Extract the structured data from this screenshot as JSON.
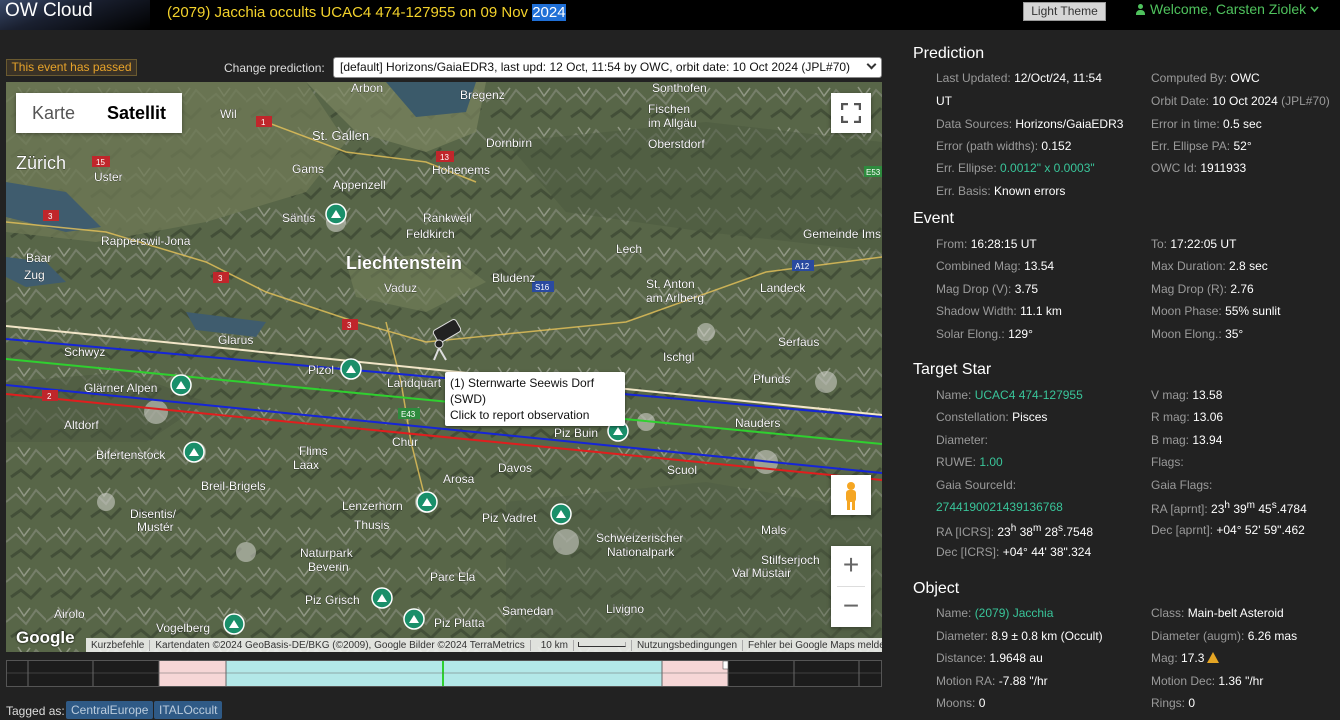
{
  "header": {
    "logo": "OW Cloud",
    "title_main": "(2079) Jacchia occults UCAC4 474-127955 on 09 Nov ",
    "title_year": "2024",
    "theme_button": "Light Theme",
    "welcome": "Welcome, Carsten Ziolek"
  },
  "controls": {
    "passed_badge": "This event has passed",
    "change_label": "Change prediction:",
    "prediction_selected": "[default] Horizons/GaiaEDR3, last upd: 12 Oct, 11:54 by OWC, orbit date: 10 Oct 2024 (JPL#70)"
  },
  "map": {
    "type_buttons": [
      "Karte",
      "Satellit"
    ],
    "active_type": "Satellit",
    "tooltip_line1": "(1) Sternwarte Seewis Dorf (SWD)",
    "tooltip_line2": "Click to report observation",
    "zoom_in": "+",
    "zoom_out": "−",
    "google": "Google",
    "footer": [
      "Kurzbefehle",
      "Kartendaten ©2024 GeoBasis-DE/BKG (©2009), Google Bilder ©2024 TerraMetrics",
      "10 km",
      "Nutzungsbedingungen",
      "Fehler bei Google Maps melden"
    ],
    "labels": [
      "Arbon",
      "Sonthofen",
      "Fischen im Allgäu",
      "Bregenz",
      "St. Gallen",
      "Dornbirn",
      "Oberstdorf",
      "Zürich",
      "Uster",
      "Hohenems",
      "Appenzell",
      "Rapperswil-Jona",
      "Säntis",
      "Rankweil",
      "Feldkirch",
      "Lech",
      "Gemeinde Ims",
      "Liechtenstein",
      "Bludenz",
      "Vaduz",
      "St. Anton am Arlberg",
      "Landeck",
      "Baar",
      "Zug",
      "Glarus",
      "Schwyz",
      "Glärner Alpen",
      "Pizol",
      "Landquart",
      "Serfaus",
      "Pfunds",
      "Ischgl",
      "Nauders",
      "Altdorf",
      "Chur",
      "Piz Buin",
      "Bifertenstock",
      "Flims",
      "Laax",
      "Davos",
      "Scuol",
      "Breil-Brigels",
      "Arosa",
      "Disentis/Mustér",
      "Lenzerhorn",
      "Thusis",
      "Piz Vadret",
      "Schweizerischer Nationalpark",
      "Mals",
      "Naturpark Beverin",
      "Val Müstair",
      "Stilfserjoch",
      "Parc Ela",
      "Piz Grisch",
      "Livigno",
      "Airolo",
      "Vogelberg",
      "Piz Platta",
      "Samedan",
      "Wil",
      "Gams"
    ],
    "road_labels": [
      "1",
      "13",
      "15",
      "3",
      "3",
      "3",
      "2",
      "E43",
      "S16",
      "A12",
      "E53",
      "13"
    ]
  },
  "tags": {
    "label": "Tagged as:",
    "items": [
      "CentralEurope",
      "ITALOccult"
    ]
  },
  "prediction": {
    "heading": "Prediction",
    "last_updated_k": "Last Updated:",
    "last_updated_v": "12/Oct/24, 11:54",
    "last_updated_v2": "UT",
    "computed_by_k": "Computed By:",
    "computed_by_v": "OWC",
    "orbit_date_k": "Orbit Date:",
    "orbit_date_v": "10 Oct 2024",
    "orbit_date_v2": "(JPL#70)",
    "data_sources_k": "Data Sources:",
    "data_sources_v": "Horizons/GaiaEDR3",
    "error_time_k": "Error in time:",
    "error_time_v": "0.5 sec",
    "error_path_k": "Error (path widths):",
    "error_path_v": "0.152",
    "err_ellipse_pa_k": "Err. Ellipse PA:",
    "err_ellipse_pa_v": "52°",
    "err_ellipse_k": "Err. Ellipse:",
    "err_ellipse_v": "0.0012\" x 0.0003\"",
    "owc_id_k": "OWC Id:",
    "owc_id_v": "1911933",
    "err_basis_k": "Err. Basis:",
    "err_basis_v": "Known errors"
  },
  "event": {
    "heading": "Event",
    "from_k": "From:",
    "from_v": "16:28:15 UT",
    "to_k": "To:",
    "to_v": "17:22:05 UT",
    "comb_mag_k": "Combined Mag:",
    "comb_mag_v": "13.54",
    "max_dur_k": "Max Duration:",
    "max_dur_v": "2.8 sec",
    "mag_drop_v_k": "Mag Drop (V):",
    "mag_drop_v_v": "3.75",
    "mag_drop_r_k": "Mag Drop (R):",
    "mag_drop_r_v": "2.76",
    "shadow_k": "Shadow Width:",
    "shadow_v": "11.1 km",
    "moon_phase_k": "Moon Phase:",
    "moon_phase_v": "55% sunlit",
    "solar_el_k": "Solar Elong.:",
    "solar_el_v": "129°",
    "moon_el_k": "Moon Elong.:",
    "moon_el_v": "35°"
  },
  "star": {
    "heading": "Target Star",
    "name_k": "Name:",
    "name_v": "UCAC4 474-127955",
    "vmag_k": "V mag:",
    "vmag_v": "13.58",
    "const_k": "Constellation:",
    "const_v": "Pisces",
    "rmag_k": "R mag:",
    "rmag_v": "13.06",
    "diam_k": "Diameter:",
    "bmag_k": "B mag:",
    "bmag_v": "13.94",
    "ruwe_k": "RUWE:",
    "ruwe_v": "1.00",
    "flags_k": "Flags:",
    "gaia_src_k": "Gaia SourceId:",
    "gaia_flags_k": "Gaia Flags:",
    "gaia_src_v": "2744190021439136768",
    "ra_aprnt_k": "RA [aprnt]:",
    "ra_aprnt_h": "23",
    "ra_aprnt_m": "39",
    "ra_aprnt_s": "45",
    "ra_aprnt_f": ".4784",
    "ra_icrs_k": "RA [ICRS]:",
    "ra_icrs_h": "23",
    "ra_icrs_m": "38",
    "ra_icrs_s": "28",
    "ra_icrs_f": ".7548",
    "dec_aprnt_k": "Dec [aprnt]:",
    "dec_aprnt_v": "+04° 52' 59\".462",
    "dec_icrs_k": "Dec [ICRS]:",
    "dec_icrs_v": "+04° 44' 38\".324"
  },
  "object": {
    "heading": "Object",
    "name_k": "Name:",
    "name_v": "(2079) Jacchia",
    "class_k": "Class:",
    "class_v": "Main-belt Asteroid",
    "diam_k": "Diameter:",
    "diam_v": "8.9 ± 0.8 km",
    "diam_src": "(Occult)",
    "diam_augm_k": "Diameter (augm):",
    "diam_augm_v": "6.26 mas",
    "dist_k": "Distance:",
    "dist_v": "1.9648 au",
    "mag_k": "Mag:",
    "mag_v": "17.3",
    "mra_k": "Motion RA:",
    "mra_v": "-7.88 \"/hr",
    "mdec_k": "Motion Dec:",
    "mdec_v": "1.36 \"/hr",
    "moons_k": "Moons:",
    "moons_v": "0",
    "rings_k": "Rings:",
    "rings_v": "0"
  },
  "colors": {
    "title_yellow": "#f3d22b",
    "green_accent": "#39c59a",
    "welcome_green": "#4fc25d",
    "passed_orange": "#e7a32a",
    "path_center": "#2fd02f",
    "path_limit": "#1525d8",
    "path_error": "#e01e1e",
    "path_outer": "#f2e6c8",
    "timeline_event": "#b3e8e8",
    "timeline_margin": "#f6d6d6"
  }
}
